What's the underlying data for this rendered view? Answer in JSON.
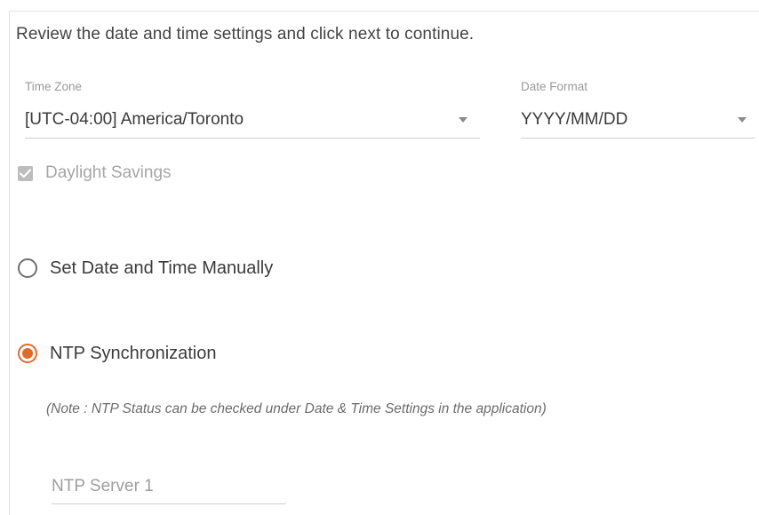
{
  "intro_text": "Review the date and time settings and click next to continue.",
  "time_zone": {
    "label": "Time Zone",
    "value": "[UTC-04:00] America/Toronto"
  },
  "date_format": {
    "label": "Date Format",
    "value": "YYYY/MM/DD"
  },
  "daylight_savings": {
    "label": "Daylight Savings",
    "checked": true,
    "disabled": true
  },
  "time_mode": {
    "options": [
      {
        "label": "Set Date and Time Manually",
        "selected": false
      },
      {
        "label": "NTP Synchronization",
        "selected": true
      }
    ]
  },
  "note": "(Note : NTP Status can be checked under Date & Time Settings in the application)",
  "ntp_server_1": {
    "placeholder": "NTP Server 1",
    "value": ""
  },
  "colors": {
    "accent": "#e06a2c",
    "disabled_checkbox": "#bdbdbd"
  }
}
